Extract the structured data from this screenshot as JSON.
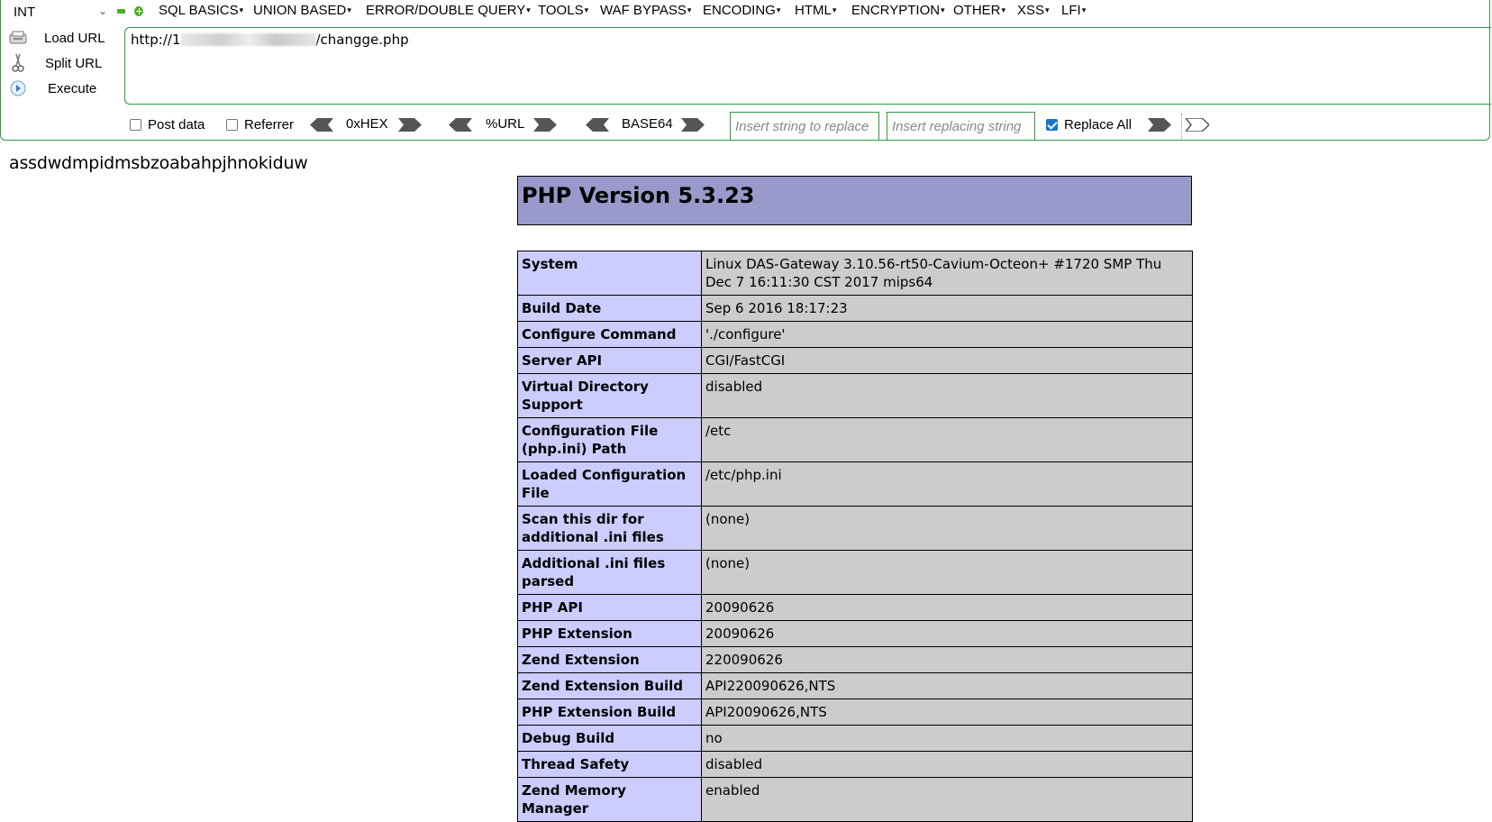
{
  "hackbar": {
    "type_select": "INT",
    "menus": [
      {
        "label": "SQL BASICS"
      },
      {
        "label": "UNION BASED"
      },
      {
        "label": "ERROR/DOUBLE QUERY"
      },
      {
        "label": "TOOLS"
      },
      {
        "label": "WAF BYPASS"
      },
      {
        "label": "ENCODING"
      },
      {
        "label": "HTML"
      },
      {
        "label": "ENCRYPTION"
      },
      {
        "label": "OTHER"
      },
      {
        "label": "XSS"
      },
      {
        "label": "LFI"
      }
    ],
    "buttons": {
      "load_url": "Load URL",
      "split_url": "Split URL",
      "execute": "Execute"
    },
    "url_prefix": "http://1",
    "url_suffix": "/changge.php",
    "options": {
      "post_data": "Post data",
      "referrer": "Referrer",
      "hex": "0xHEX",
      "url_enc": "%URL",
      "base64": "BASE64",
      "find_placeholder": "Insert string to replace",
      "replace_placeholder": "Insert replacing string",
      "replace_all": "Replace All"
    }
  },
  "page": {
    "random_text": "assdwdmpidmsbzoabahpjhnokiduw",
    "php_title": "PHP Version 5.3.23",
    "info_rows": [
      {
        "key": "System",
        "value": "Linux DAS-Gateway 3.10.56-rt50-Cavium-Octeon+ #1720 SMP Thu Dec 7 16:11:30 CST 2017 mips64"
      },
      {
        "key": "Build Date",
        "value": "Sep 6 2016 18:17:23"
      },
      {
        "key": "Configure Command",
        "value": "'./configure'"
      },
      {
        "key": "Server API",
        "value": "CGI/FastCGI"
      },
      {
        "key": "Virtual Directory Support",
        "value": "disabled"
      },
      {
        "key": "Configuration File (php.ini) Path",
        "value": "/etc"
      },
      {
        "key": "Loaded Configuration File",
        "value": "/etc/php.ini"
      },
      {
        "key": "Scan this dir for additional .ini files",
        "value": "(none)"
      },
      {
        "key": "Additional .ini files parsed",
        "value": "(none)"
      },
      {
        "key": "PHP API",
        "value": "20090626"
      },
      {
        "key": "PHP Extension",
        "value": "20090626"
      },
      {
        "key": "Zend Extension",
        "value": "220090626"
      },
      {
        "key": "Zend Extension Build",
        "value": "API220090626,NTS"
      },
      {
        "key": "PHP Extension Build",
        "value": "API20090626,NTS"
      },
      {
        "key": "Debug Build",
        "value": "no"
      },
      {
        "key": "Thread Safety",
        "value": "disabled"
      },
      {
        "key": "Zend Memory Manager",
        "value": "enabled"
      }
    ]
  }
}
